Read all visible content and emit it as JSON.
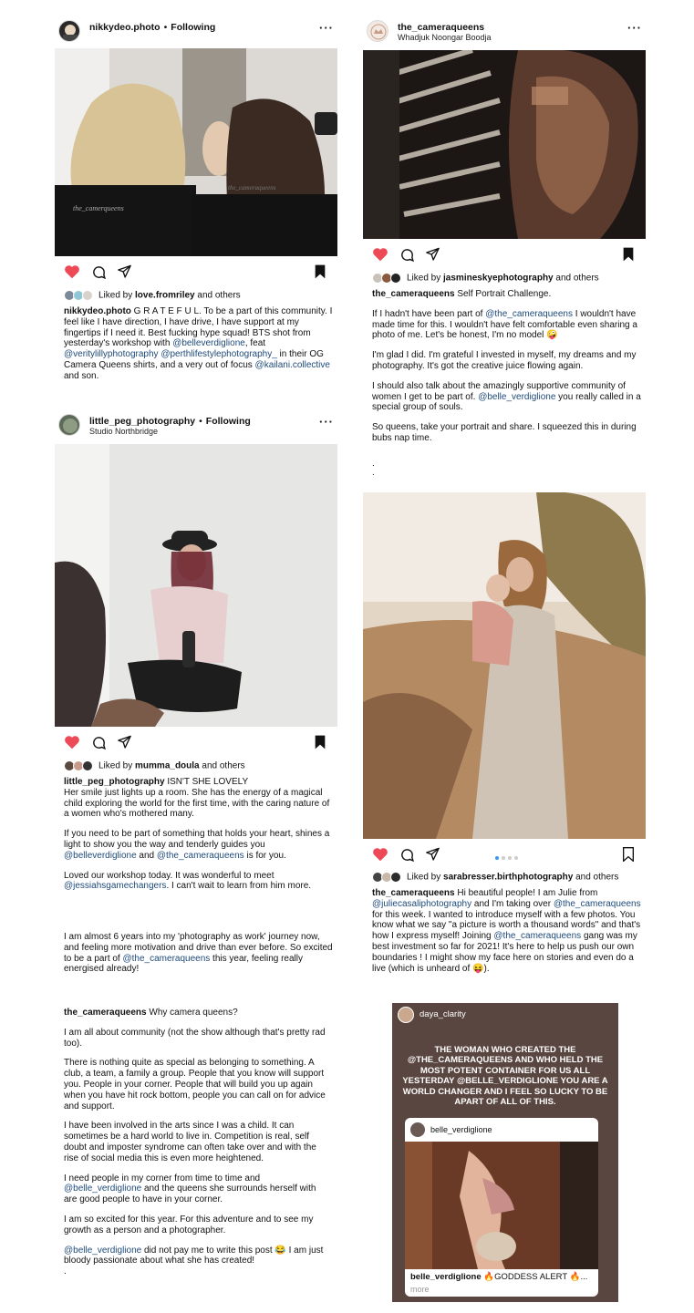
{
  "colors": {
    "accent_heart": "#ed4956",
    "link": "#1e4a7a",
    "story_bg": "#5a4640"
  },
  "post1": {
    "username": "nikkydeo.photo",
    "follow": "Following",
    "liked_by": "love.fromriley",
    "liked_prefix": "Liked by",
    "and_others": "and others",
    "caption": [
      {
        "t": "b",
        "v": "nikkydeo.photo"
      },
      {
        "t": "s",
        "v": " G R A T E F U L. To be a part of this community. I feel like I have direction, I have drive, I have support at my fingertips if I need it. Best fucking hype squad! BTS shot from yesterday's workshop with "
      },
      {
        "t": "l",
        "v": "@belleverdiglione"
      },
      {
        "t": "s",
        "v": ", feat "
      },
      {
        "t": "l",
        "v": "@veritylillyphotography"
      },
      {
        "t": "s",
        "v": " "
      },
      {
        "t": "l",
        "v": "@perthlifestylephotography_"
      },
      {
        "t": "s",
        "v": " in their OG Camera Queens shirts, and a very out of focus "
      },
      {
        "t": "l",
        "v": "@kailani.collective"
      },
      {
        "t": "s",
        "v": " and son."
      }
    ]
  },
  "post2": {
    "username": "the_cameraqueens",
    "location": "Whadjuk Noongar Boodja",
    "liked_by": "jasmineskyephotography",
    "liked_prefix": "Liked by",
    "and_others": "and others",
    "paragraphs": [
      [
        {
          "t": "b",
          "v": "the_cameraqueens"
        },
        {
          "t": "s",
          "v": " Self Portrait Challenge."
        }
      ],
      [
        {
          "t": "s",
          "v": "If I hadn't have been part of "
        },
        {
          "t": "l",
          "v": "@the_cameraqueens"
        },
        {
          "t": "s",
          "v": " I wouldn't have made time for this. I wouldn't have felt comfortable even sharing a photo of me. Let's be honest, I'm no model 🤪"
        }
      ],
      [
        {
          "t": "s",
          "v": "I'm glad I did. I'm grateful I invested in myself, my dreams and my photography. It's got the creative juice flowing again."
        }
      ],
      [
        {
          "t": "s",
          "v": "I should also talk about the amazingly supportive community of women I get to be part of. "
        },
        {
          "t": "l",
          "v": "@belle_verdiglione"
        },
        {
          "t": "s",
          "v": " you really called in a special group of souls."
        }
      ],
      [
        {
          "t": "s",
          "v": "So queens, take your portrait and share. I squeezed this in during bubs nap time."
        }
      ]
    ],
    "trailing_dots": [
      ".",
      "."
    ]
  },
  "post3": {
    "username": "little_peg_photography",
    "follow": "Following",
    "location": "Studio Northbridge",
    "liked_by": "mumma_doula",
    "liked_prefix": "Liked by",
    "and_others": "and others",
    "paragraphs": [
      [
        {
          "t": "b",
          "v": "little_peg_photography"
        },
        {
          "t": "s",
          "v": " ISN'T SHE LOVELY"
        },
        {
          "t": "br"
        },
        {
          "t": "s",
          "v": "Her smile just lights up a room. She has the energy of a magical child exploring the world for the first time, with the caring nature of a women who's mothered many."
        }
      ],
      [
        {
          "t": "s",
          "v": "If you need to be part of something that holds your heart, shines a light to show you the way and tenderly guides you "
        },
        {
          "t": "l",
          "v": "@belleverdiglione"
        },
        {
          "t": "s",
          "v": " and "
        },
        {
          "t": "l",
          "v": "@the_cameraqueens"
        },
        {
          "t": "s",
          "v": " is for you."
        }
      ],
      [
        {
          "t": "s",
          "v": "Loved our workshop today. It was wonderful to meet "
        },
        {
          "t": "l",
          "v": "@jessiahsgamechangers"
        },
        {
          "t": "s",
          "v": ". I can't wait to learn from him more."
        }
      ]
    ]
  },
  "post4": {
    "liked_by": "sarabresser.birthphotography",
    "liked_prefix": "Liked by",
    "and_others": "and others",
    "caption": [
      {
        "t": "b",
        "v": "the_cameraqueens"
      },
      {
        "t": "s",
        "v": " Hi beautiful people! I am Julie from "
      },
      {
        "t": "l",
        "v": "@juliecasaliphotography"
      },
      {
        "t": "s",
        "v": " and I'm taking over "
      },
      {
        "t": "l",
        "v": "@the_cameraqueens"
      },
      {
        "t": "s",
        "v": " for this week. I wanted to introduce myself with a few photos. You know what we say \"a picture is worth a thousand words\" and that's how I express myself! Joining "
      },
      {
        "t": "l",
        "v": "@the_cameraqueens"
      },
      {
        "t": "s",
        "v": " gang was my best investment so far for 2021! It's here to help us push our own boundaries ! I might show my face here on stories and even do a live (which is unheard of 😝)."
      }
    ]
  },
  "text5": [
    [
      {
        "t": "s",
        "v": "I am almost 6 years into my 'photography as work' journey now, and feeling more motivation and drive than ever before. So excited to be a part of "
      },
      {
        "t": "l",
        "v": "@the_cameraqueens"
      },
      {
        "t": "s",
        "v": " this year, feeling really energised already!"
      }
    ]
  ],
  "text6": [
    [
      {
        "t": "b",
        "v": "the_cameraqueens"
      },
      {
        "t": "s",
        "v": " Why camera queens?"
      }
    ],
    [
      {
        "t": "s",
        "v": "I am all about community (not the show although that's pretty rad too)."
      }
    ],
    [
      {
        "t": "s",
        "v": "There is nothing quite as special as belonging to something. A club, a team, a family a group. People that you know will support you. People in your corner. People that will build you up again when you have hit rock bottom, people you can call on for advice and support."
      }
    ],
    [
      {
        "t": "s",
        "v": "I have been involved in the arts since I was a child. It can sometimes be a hard world to live in. Competition is real, self doubt and imposter syndrome can often take over and with the rise of social media this is even more heightened."
      }
    ],
    [
      {
        "t": "s",
        "v": "I need people in my corner from time to time and "
      },
      {
        "t": "l",
        "v": "@belle_verdiglione"
      },
      {
        "t": "s",
        "v": "  and the queens she surrounds herself with are good people to have in your corner."
      }
    ],
    [
      {
        "t": "s",
        "v": "I am so excited for this year. For this adventure and to see my growth as a person and a photographer."
      }
    ],
    [
      {
        "t": "l",
        "v": "@belle_verdiglione"
      },
      {
        "t": "s",
        "v": "  did not pay me to write this post 😂 I am just bloody passionate about what she has created!"
      },
      {
        "t": "br"
      },
      {
        "t": "s",
        "v": "."
      }
    ]
  ],
  "story": {
    "username": "daya_clarity",
    "text": "THE WOMAN WHO CREATED THE @THE_CAMERAQUEENS AND WHO HELD THE MOST POTENT CONTAINER FOR US ALL YESTERDAY @BELLE_VERDIGLIONE YOU ARE A WORLD CHANGER AND I FEEL SO LUCKY TO BE APART OF ALL OF THIS.",
    "card_user": "belle_verdiglione",
    "card_caption_user": "belle_verdiglione",
    "card_caption": " 🔥GODDESS ALERT 🔥...",
    "card_more": "more"
  },
  "icons": [
    "heart-icon",
    "comment-icon",
    "share-icon",
    "bookmark-icon",
    "more-icon"
  ]
}
